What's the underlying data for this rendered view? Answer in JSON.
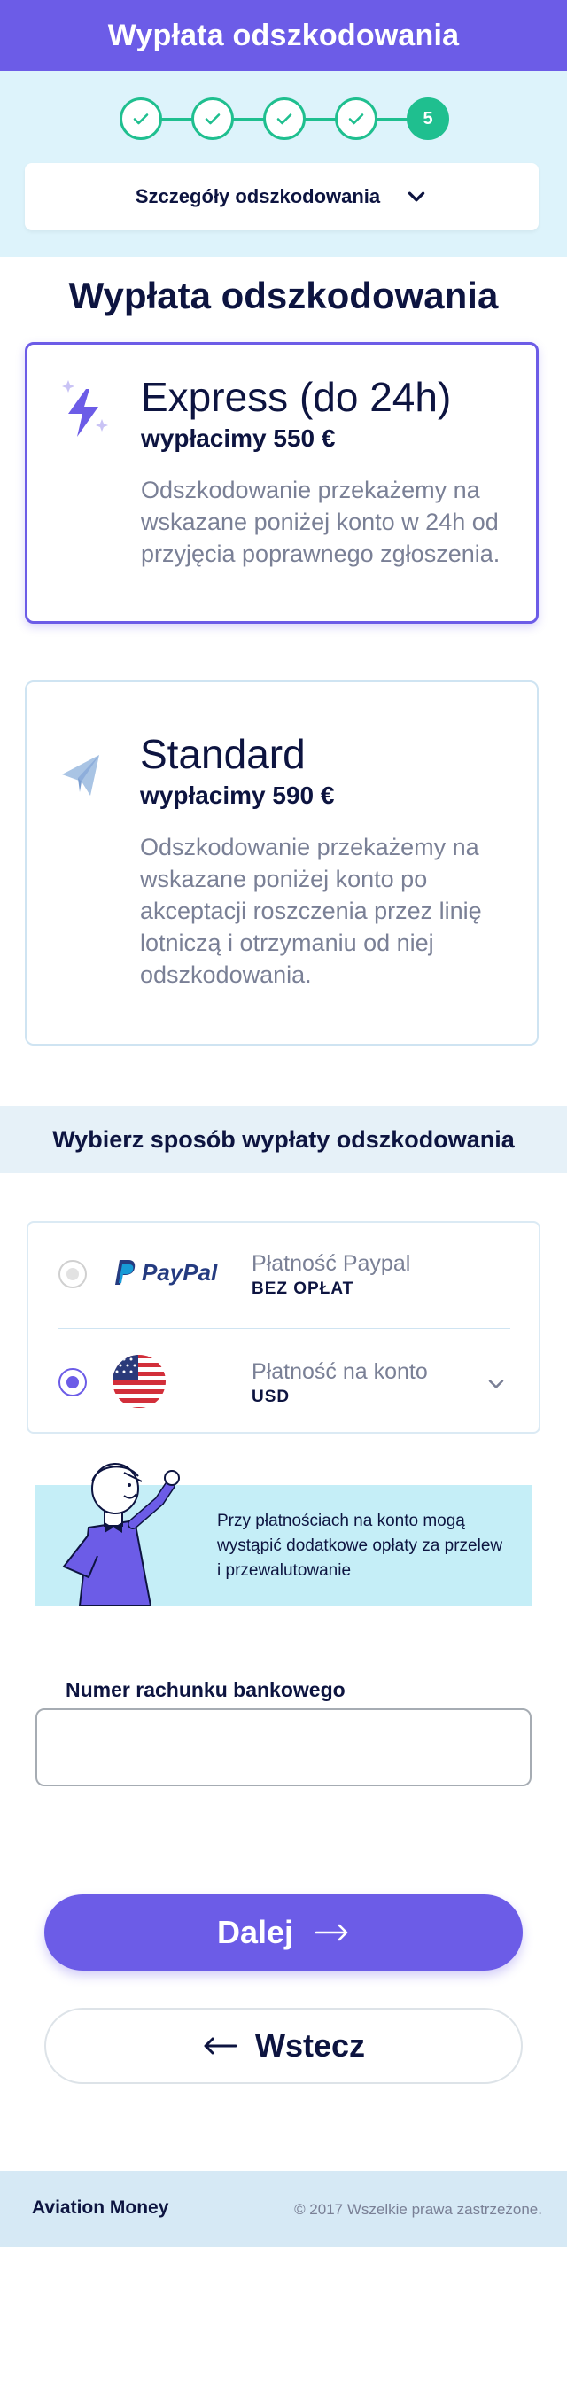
{
  "header": {
    "title": "Wypłata odszkodowania"
  },
  "stepper": {
    "current_step": "5",
    "completed_steps": 4,
    "colors": {
      "complete": "#1fbf8f"
    }
  },
  "details_toggle": {
    "label": "Szczegóły odszkodowania",
    "icon": "chevron-down-icon"
  },
  "section_title": "Wypłata odszkodowania",
  "payout_options": [
    {
      "title": "Express (do 24h)",
      "amount": "wypłacimy 550 €",
      "description": "Odszkodowanie przekażemy na wskazane poniżej konto w 24h od przyjęcia poprawnego zgłoszenia.",
      "icon": "lightning-icon",
      "selected": true
    },
    {
      "title": "Standard",
      "amount": "wypłacimy 590 €",
      "description": "Odszkodowanie przekażemy na wskazane poniżej konto po akceptacji roszczenia przez linię lotniczą i otrzymaniu od niej odszkodowania.",
      "icon": "paper-plane-icon",
      "selected": false
    }
  ],
  "method_band": {
    "title": "Wybierz sposób wypłaty odszkodowania"
  },
  "payment_methods": [
    {
      "name": "Płatność Paypal",
      "sub": "BEZ OPŁAT",
      "logo": "paypal-logo",
      "logo_text": "PayPal",
      "selected": false
    },
    {
      "name": "Płatność na konto",
      "sub": "USD",
      "logo": "us-flag-icon",
      "selected": true
    }
  ],
  "info_box": {
    "text": "Przy płatnościach na konto mogą wystąpić dodatkowe opłaty za przelew i przewalutowanie"
  },
  "account_field": {
    "label": "Numer rachunku bankowego",
    "value": "",
    "placeholder": ""
  },
  "buttons": {
    "next": "Dalej",
    "back": "Wstecz"
  },
  "footer": {
    "brand": "Aviation Money",
    "copyright": "© 2017 Wszelkie prawa zastrzeżone."
  },
  "colors": {
    "accent": "#6c5ce7",
    "success": "#1fbf8f",
    "light_bg": "#ddf3fb"
  }
}
